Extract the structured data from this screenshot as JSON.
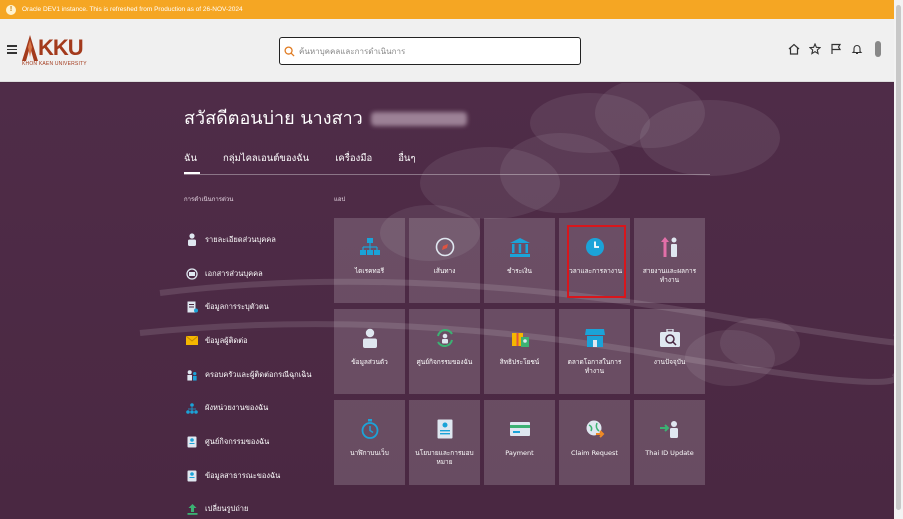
{
  "banner": {
    "text": "Oracle DEV1 instance. This is refreshed from Production as of 26-NOV-2024",
    "icon": "warning-icon"
  },
  "header": {
    "logo_text": "KKU",
    "logo_subtitle": "KHON KAEN UNIVERSITY",
    "search_placeholder": "ค้นหาบุคคลและการดำเนินการ",
    "icons": [
      "home-icon",
      "star-icon",
      "flag-icon",
      "bell-icon",
      "avatar"
    ]
  },
  "greeting": "สวัสดีตอนบ่าย นางสาว",
  "tabs": [
    "ฉัน",
    "กลุ่มไคลเอนต์ของฉัน",
    "เครื่องมือ",
    "อื่นๆ"
  ],
  "quick_actions": {
    "heading": "การดำเนินการด่วน",
    "items": [
      {
        "label": "รายละเอียดส่วนบุคคล",
        "icon": "person-icon"
      },
      {
        "label": "เอกสารส่วนบุคคล",
        "icon": "document-globe-icon"
      },
      {
        "label": "ข้อมูลการระบุตัวตน",
        "icon": "id-document-icon"
      },
      {
        "label": "ข้อมูลผู้ติดต่อ",
        "icon": "envelope-icon"
      },
      {
        "label": "ครอบครัวและผู้ติดต่อกรณีฉุกเฉิน",
        "icon": "family-icon"
      },
      {
        "label": "ผังหน่วยงานของฉัน",
        "icon": "org-chart-icon"
      },
      {
        "label": "ศูนย์กิจกรรมของฉัน",
        "icon": "badge-icon"
      },
      {
        "label": "ข้อมูลสาธารณะของฉัน",
        "icon": "badge-icon"
      },
      {
        "label": "เปลี่ยนรูปถ่าย",
        "icon": "upload-icon"
      }
    ]
  },
  "apps": {
    "heading": "แอป",
    "tiles": [
      {
        "label": "ไดเรคทอรี",
        "icon": "directory-icon"
      },
      {
        "label": "เส้นทาง",
        "icon": "compass-icon"
      },
      {
        "label": "ชำระเงิน",
        "icon": "bank-icon"
      },
      {
        "label": "เวลาและการลางาน",
        "icon": "clock-icon"
      },
      {
        "label": "สายงานและผลการทำงาน",
        "icon": "career-icon"
      },
      {
        "label": "ข้อมูลส่วนตัว",
        "icon": "person-tile-icon"
      },
      {
        "label": "ศูนย์กิจกรรมของฉัน",
        "icon": "refresh-person-icon"
      },
      {
        "label": "สิทธิประโยชน์",
        "icon": "benefits-icon"
      },
      {
        "label": "ตลาดโอกาสในการทำงาน",
        "icon": "marketplace-icon"
      },
      {
        "label": "งานปัจจุบัน",
        "icon": "briefcase-icon"
      },
      {
        "label": "นาฬิกาบนเว็บ",
        "icon": "stopwatch-icon"
      },
      {
        "label": "นโยบายและการมอบหมาย",
        "icon": "policy-icon"
      },
      {
        "label": "Payment",
        "icon": "payment-icon"
      },
      {
        "label": "Claim Request",
        "icon": "globe-arrow-icon"
      },
      {
        "label": "Thai ID Update",
        "icon": "id-update-icon"
      }
    ]
  },
  "colors": {
    "banner": "#f5a623",
    "accent": "#1ba3d8",
    "highlight": "#d8161c",
    "background": "#4a2842"
  }
}
